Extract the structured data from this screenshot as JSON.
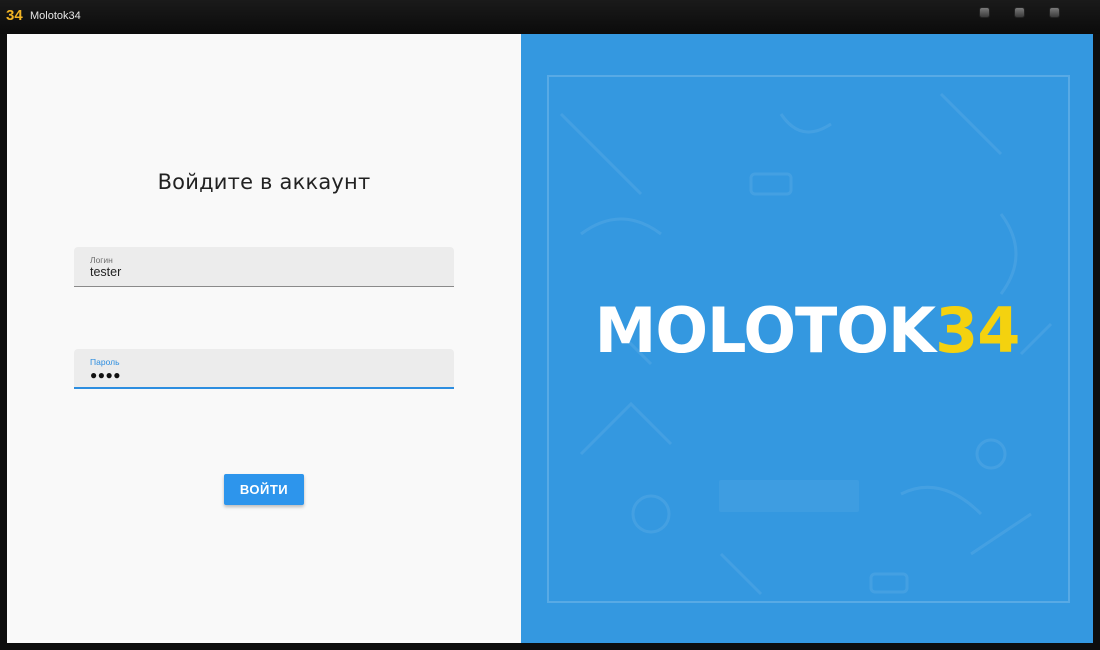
{
  "window": {
    "icon_text": "34",
    "title": "Molotok34"
  },
  "login_form": {
    "heading": "Войдите в аккаунт",
    "login_field": {
      "label": "Логин",
      "value": "tester"
    },
    "password_field": {
      "label": "Пароль",
      "masked_value": "●●●●"
    },
    "submit_label": "ВОЙТИ"
  },
  "brand": {
    "logo_word": "MOLOTOK",
    "logo_number": "34"
  },
  "colors": {
    "accent": "#2d95ec",
    "brand_panel": "#3498e0",
    "logo_number": "#f4d20f",
    "app_icon": "#f1b324"
  },
  "icons": [
    "app-icon",
    "minimize-icon",
    "maximize-icon",
    "close-icon"
  ]
}
